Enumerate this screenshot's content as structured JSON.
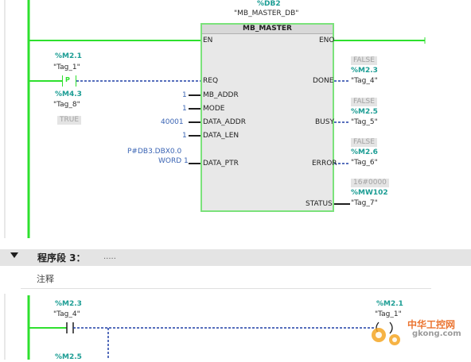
{
  "network2": {
    "instance_address": "%DB2",
    "instance_name": "\"MB_MASTER_DB\"",
    "block_title": "MB_MASTER",
    "pins_in": [
      "EN",
      "REQ",
      "MB_ADDR",
      "MODE",
      "DATA_ADDR",
      "DATA_LEN",
      "DATA_PTR"
    ],
    "pins_out": [
      "ENO",
      "DONE",
      "BUSY",
      "ERROR",
      "STATUS"
    ],
    "req_contact": {
      "addr": "%M2.1",
      "tag": "\"Tag_1\"",
      "symbol": "P",
      "edge_addr": "%M4.3",
      "edge_tag": "\"Tag_8\"",
      "state": "TRUE"
    },
    "params": {
      "mb_addr": "1",
      "mode": "1",
      "data_addr": "40001",
      "data_len": "1",
      "data_ptr_line1": "P#DB3.DBX0.0",
      "data_ptr_line2": "WORD 1"
    },
    "outputs": {
      "done_state": "FALSE",
      "done_addr": "%M2.3",
      "done_tag": "\"Tag_4\"",
      "busy_state": "FALSE",
      "busy_addr": "%M2.5",
      "busy_tag": "\"Tag_5\"",
      "error_state": "FALSE",
      "error_addr": "%M2.6",
      "error_tag": "\"Tag_6\"",
      "status_state": "16#0000",
      "status_addr": "%MW102",
      "status_tag": "\"Tag_7\""
    }
  },
  "network3": {
    "title": "程序段 3：",
    "ellipsis": ".....",
    "comment": "注释",
    "contact1_addr": "%M2.3",
    "contact1_tag": "\"Tag_4\"",
    "coil_addr": "%M2.1",
    "coil_tag": "\"Tag_1\"",
    "contact2_addr": "%M2.5"
  },
  "watermark": {
    "text": "中华工控网",
    "url": "gkong.com"
  },
  "colors": {
    "power_flow": "#2ee02e",
    "dashed": "#1f3fa6",
    "address": "#1c9d94",
    "value": "#3a64b4",
    "block_bg": "#e8e8e8"
  }
}
